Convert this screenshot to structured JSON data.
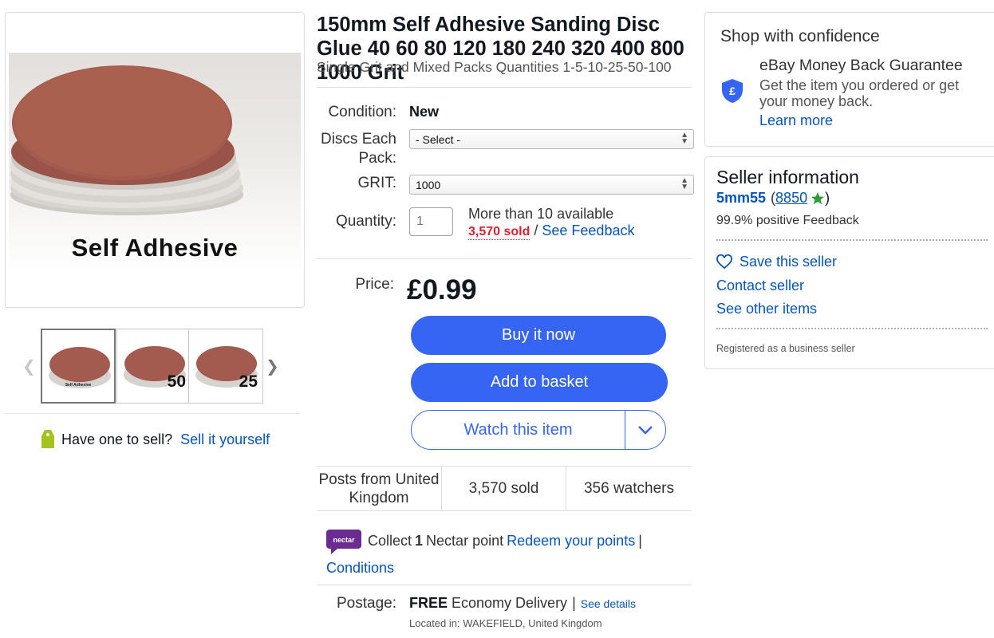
{
  "listing": {
    "title": "150mm Self Adhesive Sanding Disc Glue 40 60 80 120 180 240 320 400 800 1000 Grit",
    "subtitle": "Single Grit and Mixed Packs Quantities 1-5-10-25-50-100"
  },
  "gallery": {
    "main_caption": "Self Adhesive",
    "thumbnails": [
      {
        "tag": "",
        "mini": "Self Adhesive",
        "selected": true
      },
      {
        "tag": "50",
        "mini": "",
        "selected": false
      },
      {
        "tag": "25",
        "mini": "",
        "selected": false
      }
    ],
    "prev_icon": "chevron-left-icon",
    "next_icon": "chevron-right-icon"
  },
  "sell": {
    "question": "Have one to sell?",
    "link": "Sell it yourself"
  },
  "details": {
    "condition_label": "Condition:",
    "condition_value": "New",
    "pack_label": "Discs Each Pack:",
    "pack_selected": "- Select -",
    "grit_label": "GRIT:",
    "grit_selected": "1000",
    "quantity_label": "Quantity:",
    "quantity_placeholder": "1",
    "availability": "More than 10 available",
    "sold_link": "3,570 sold",
    "separator": "/",
    "feedback_link": "See Feedback",
    "price_label": "Price:",
    "price": "£0.99"
  },
  "actions": {
    "buy_now": "Buy it now",
    "add_basket": "Add to basket",
    "watch": "Watch this item",
    "accent_color": "#3665f3"
  },
  "stats": {
    "location": "Posts from United Kingdom",
    "sold": "3,570 sold",
    "watchers": "356 watchers"
  },
  "nectar": {
    "collect": "Collect",
    "points": "1",
    "point_text": "Nectar point",
    "redeem": "Redeem your points",
    "pipe": "|",
    "conditions": "Conditions"
  },
  "postage": {
    "label": "Postage:",
    "free": "FREE",
    "service": "Economy Delivery",
    "pipe": "|",
    "details": "See details",
    "located": "Located in: WAKEFIELD, United Kingdom"
  },
  "confidence": {
    "title": "Shop with confidence",
    "guarantee_title": "eBay Money Back Guarantee",
    "guarantee_desc": "Get the item you ordered or get your money back.",
    "learn_more": "Learn more",
    "icon": "pound-shield-icon"
  },
  "seller": {
    "title": "Seller information",
    "username": "5mm55",
    "open_paren": "(",
    "score": "8850",
    "close_paren": ")",
    "positive": "99.9% positive Feedback",
    "save": "Save this seller",
    "contact": "Contact seller",
    "other_items": "See other items",
    "registered": "Registered as a business seller",
    "star_color": "#2d9c3c"
  }
}
